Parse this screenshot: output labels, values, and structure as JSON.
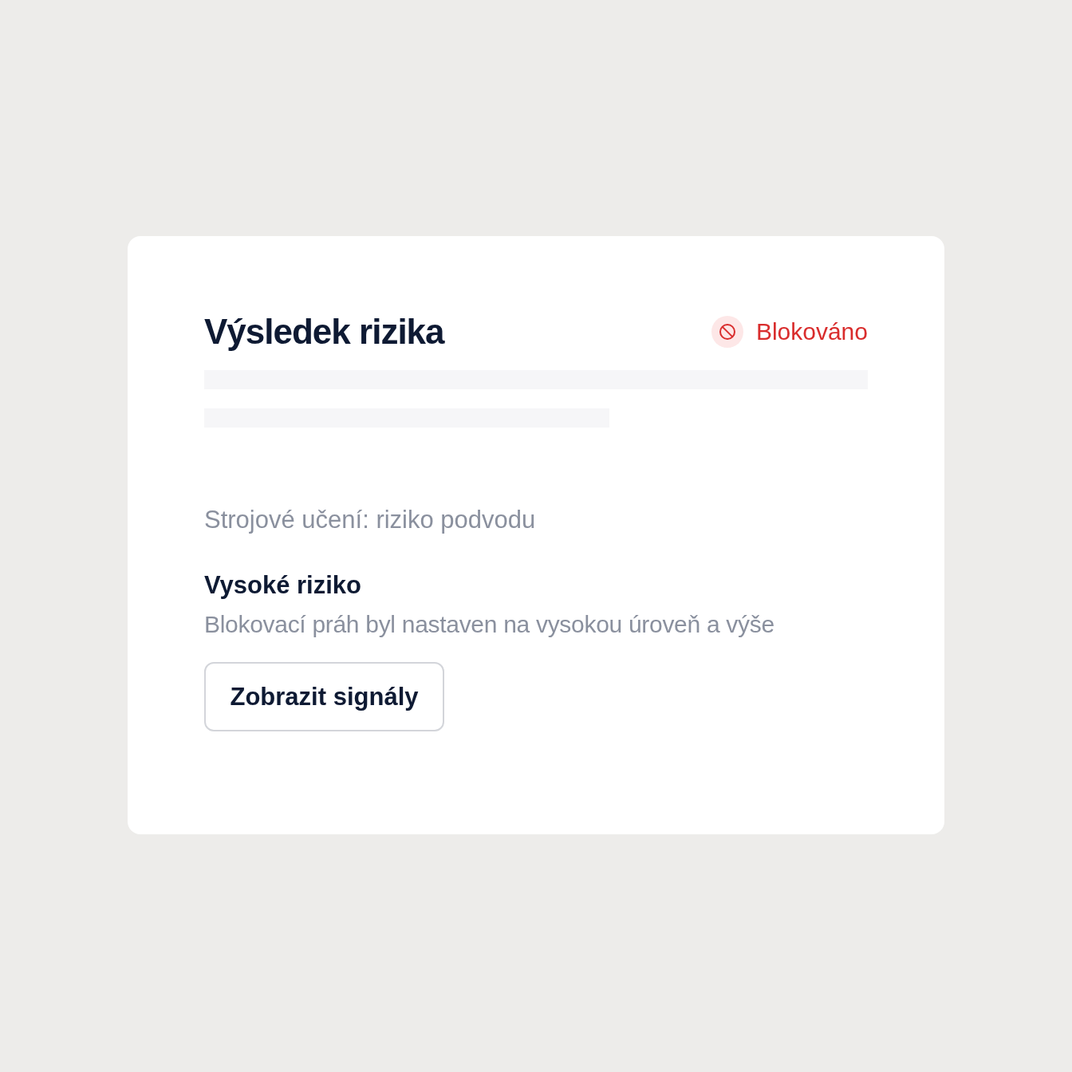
{
  "card": {
    "title": "Výsledek rizika",
    "status": {
      "kind": "blocked",
      "label": "Blokováno"
    },
    "model_label": "Strojové učení: riziko podvodu",
    "risk_level": "Vysoké riziko",
    "description": "Blokovací práh byl nastaven na vysokou úroveň a výše",
    "button": "Zobrazit signály"
  }
}
